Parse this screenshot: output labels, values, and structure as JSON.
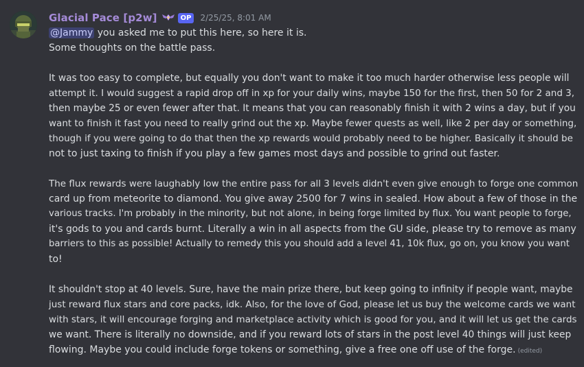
{
  "message": {
    "author": "Glacial Pace [p2w]",
    "op_badge": "OP",
    "timestamp": "2/25/25, 8:01 AM",
    "mention": "@Jammy",
    "first_line_rest": " you asked me to put this here, so here it is.",
    "paragraphs": [
      [
        "Some thoughts on the battle pass."
      ],
      [
        "It was too easy to complete, but equally you don't want to make it too much harder otherwise less people will",
        "attempt it. I would suggest a rapid drop off in xp for your daily wins, maybe 150 for the first, then 50 for 2 and 3,",
        "then maybe 25 or even fewer after that. It means that you can reasonably finish it with 2 wins a day, but if you",
        "want to finish it fast you need to really grind out the xp. Maybe fewer quests as well, like 2 per day or something,",
        "though if you were going to do that then the xp rewards would probably need to be higher. Basically it should be",
        "not to just taxing to finish if you play a few games most days and possible to grind out faster."
      ],
      [
        "The flux rewards were laughably low the entire pass for all 3 levels didn't even give enough to forge one common",
        "card up from meteorite to diamond. You give away 2500 for 7 wins in sealed. How about a few of those in the",
        "various tracks. I'm probably in the minority, but not alone, in being forge limited by flux. You want people to forge,",
        "it's gods to you and cards burnt. Literally a win in all aspects from the GU side, please try to remove as many",
        "barriers to this as possible! Actually to remedy this you should add a level 41, 10k flux, go on, you know you want",
        "to!"
      ],
      [
        "It shouldn't stop at 40 levels. Sure, have the main prize there, but keep going to infinity if people want, maybe",
        "just reward flux stars and core packs, idk. Also, for the love of God, please let us buy the welcome cards we want",
        "with stars, it will encourage forging and marketplace activity which is good for you, and it will let us get the cards",
        "we want. There is literally no downside, and if you reward lots of stars in the post level 40 things will just keep",
        "flowing. Maybe you could include forge tokens or something, give a free one off use of the forge."
      ]
    ],
    "edited_label": "(edited)"
  },
  "colors": {
    "background": "#323339",
    "username": "#a58bd8",
    "op_badge": "#5865f2",
    "text": "#dbdee1",
    "muted": "#949ba4"
  },
  "icons": {
    "avatar": "soldier-helmet-avatar",
    "role": "rank-wings-icon"
  }
}
